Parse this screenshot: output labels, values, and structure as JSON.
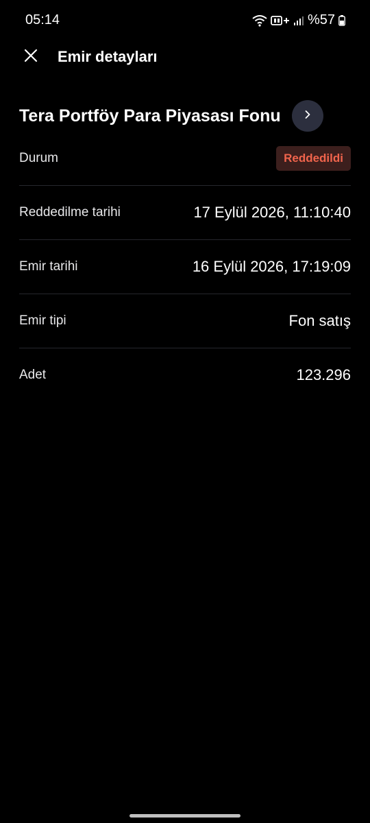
{
  "status_bar": {
    "time": "05:14",
    "battery_text": "%57",
    "icons": [
      "wifi-icon",
      "volte-icon",
      "signal-icon",
      "battery-icon"
    ]
  },
  "header": {
    "close_icon": "close-icon",
    "title": "Emir detayları"
  },
  "fund": {
    "name": "Tera Portföy Para Piyasası Fonu",
    "go_icon": "chevron-right-icon"
  },
  "details": {
    "status_label": "Durum",
    "status_value": "Reddedildi",
    "rejection_date_label": "Reddedilme tarihi",
    "rejection_date_value": "17 Eylül 2026, 11:10:40",
    "order_date_label": "Emir tarihi",
    "order_date_value": "16 Eylül 2026, 17:19:09",
    "order_type_label": "Emir tipi",
    "order_type_value": "Fon satış",
    "quantity_label": "Adet",
    "quantity_value": "123.296"
  },
  "colors": {
    "background": "#000000",
    "badge_bg": "#3c1f1d",
    "badge_text": "#f0644c",
    "fund_button_bg": "#2c2f3e",
    "divider": "#26272d"
  }
}
